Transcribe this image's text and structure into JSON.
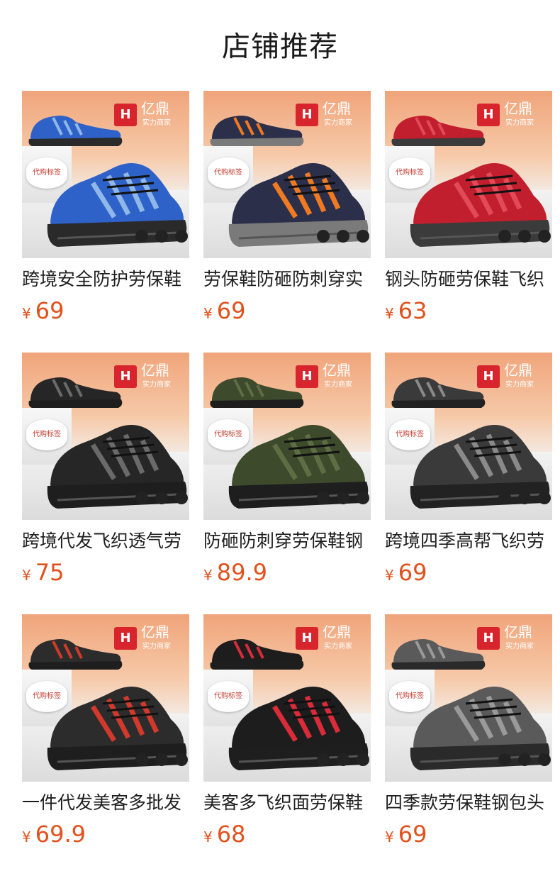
{
  "header": {
    "title": "店铺推荐"
  },
  "brand": {
    "logo_mark": "H",
    "name": "亿鼎",
    "tagline": "实力商家",
    "tag_label": "代购标签"
  },
  "currency": "¥",
  "products": [
    {
      "name": "跨境安全防护劳保鞋",
      "price": "69",
      "upper": "#2f62c8",
      "accent": "#8fb7e8",
      "sole": "#2a2a2a"
    },
    {
      "name": "劳保鞋防砸防刺穿实",
      "price": "69",
      "upper": "#2b2f4a",
      "accent": "#f07a22",
      "sole": "#7a7a7a"
    },
    {
      "name": "钢头防砸劳保鞋飞织",
      "price": "63",
      "upper": "#c21f2e",
      "accent": "#e24a57",
      "sole": "#3b3b3b"
    },
    {
      "name": "跨境代发飞织透气劳",
      "price": "75",
      "upper": "#262626",
      "accent": "#6a6a6a",
      "sole": "#1e1e1e"
    },
    {
      "name": "防砸防刺穿劳保鞋钢",
      "price": "89.9",
      "upper": "#3d4a2c",
      "accent": "#5f6d44",
      "sole": "#1e1e1e"
    },
    {
      "name": "跨境四季高帮飞织劳",
      "price": "69",
      "upper": "#3a3a3a",
      "accent": "#8a8a8a",
      "sole": "#222222"
    },
    {
      "name": "一件代发美客多批发",
      "price": "69.9",
      "upper": "#2c2c2c",
      "accent": "#d0392b",
      "sole": "#1e1e1e"
    },
    {
      "name": "美客多飞织面劳保鞋",
      "price": "68",
      "upper": "#1d1d1d",
      "accent": "#d92b3a",
      "sole": "#1e1e1e"
    },
    {
      "name": "四季款劳保鞋钢包头",
      "price": "69",
      "upper": "#5a5a5a",
      "accent": "#9a9a9a",
      "sole": "#2a2a2a"
    }
  ]
}
